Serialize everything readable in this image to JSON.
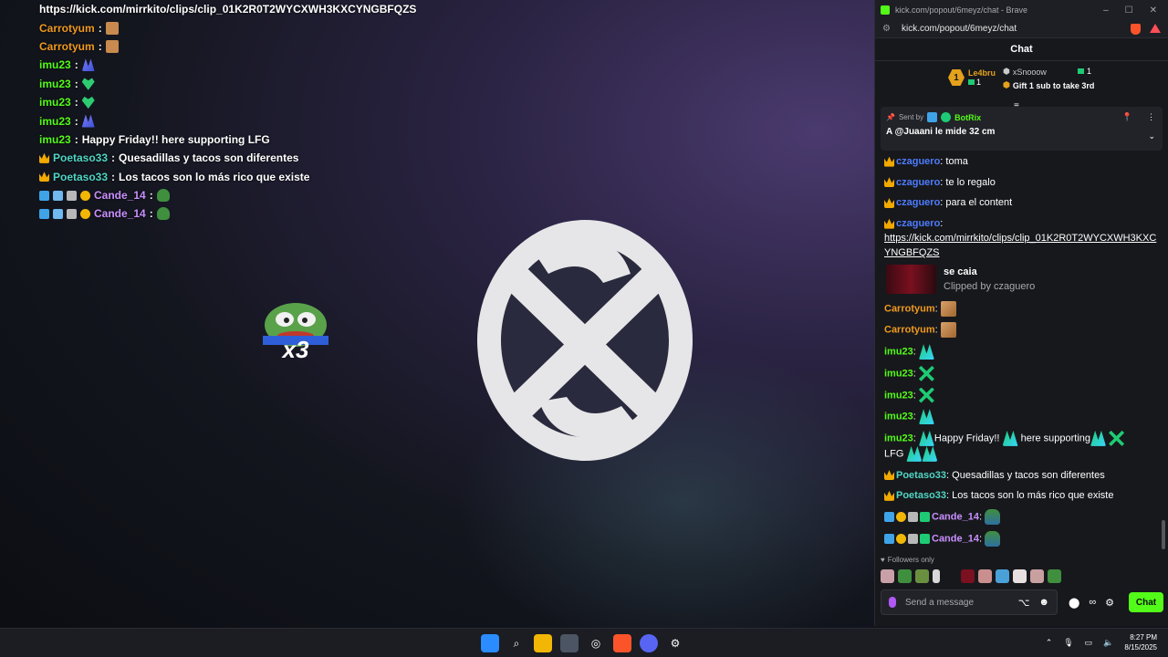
{
  "overlay_chat": [
    {
      "user": "https://kick.com/mirrkito/clips/clip_01K2R0T2WYCXWH3KXCYNGBFQZS",
      "color": "#ffffff",
      "badges": [],
      "emotes": [],
      "text": ""
    },
    {
      "user": "Carrotyum",
      "color": "#f09a1e",
      "badges": [],
      "emotes": [
        "box"
      ],
      "text": ""
    },
    {
      "user": "Carrotyum",
      "color": "#f09a1e",
      "badges": [],
      "emotes": [
        "box"
      ],
      "text": ""
    },
    {
      "user": "imu23",
      "color": "#53fc18",
      "badges": [],
      "emotes": [
        "wings"
      ],
      "text": ""
    },
    {
      "user": "imu23",
      "color": "#53fc18",
      "badges": [],
      "emotes": [
        "heart"
      ],
      "text": ""
    },
    {
      "user": "imu23",
      "color": "#53fc18",
      "badges": [],
      "emotes": [
        "heart"
      ],
      "text": ""
    },
    {
      "user": "imu23",
      "color": "#53fc18",
      "badges": [],
      "emotes": [
        "wings"
      ],
      "text": ""
    },
    {
      "user": "imu23",
      "color": "#53fc18",
      "badges": [],
      "emotes": [],
      "text": "Happy Friday!! here supporting LFG"
    },
    {
      "user": "Poetaso33",
      "color": "#4fd6c4",
      "badges": [
        "crown"
      ],
      "emotes": [],
      "text": "Quesadillas y tacos son diferentes"
    },
    {
      "user": "Poetaso33",
      "color": "#4fd6c4",
      "badges": [
        "crown"
      ],
      "emotes": [],
      "text": "Los tacos son lo más rico que existe"
    },
    {
      "user": "Cande_14",
      "color": "#c98fff",
      "badges": [
        "blue",
        "cube",
        "grey",
        "coin"
      ],
      "emotes": [
        "frog"
      ],
      "text": ""
    },
    {
      "user": "Cande_14",
      "color": "#c98fff",
      "badges": [
        "blue",
        "cube",
        "grey",
        "coin"
      ],
      "emotes": [
        "frog"
      ],
      "text": ""
    }
  ],
  "browser": {
    "title": "kick.com/popout/6meyz/chat - Brave",
    "url": "kick.com/popout/6meyz/chat",
    "controls": [
      "–",
      "☐",
      "✕"
    ]
  },
  "chat": {
    "header": "Chat",
    "leaderboard": {
      "first_rank": "1",
      "first_name": "Le4bru",
      "first_count": "1",
      "second_name": "xSnooow",
      "second_count": "1",
      "gift_text": "Gift 1 sub to take 3rd"
    },
    "pinned": {
      "sent_by": "Sent by",
      "bot": "BotRix",
      "message": "A @Juaani le mide 32 cm"
    },
    "messages": {
      "m1_user": "czaguero",
      "m1_text": "toma",
      "m2_user": "czaguero",
      "m2_text": "te lo regalo",
      "m3_user": "czaguero",
      "m3_text": "para el content",
      "m4_user": "czaguero",
      "m4_link": "https://kick.com/mirrkito/clips/clip_01K2R0T2WYCXWH3KXCYNGBFQZS",
      "clip_title": "se caia",
      "clip_by": "Clipped by czaguero",
      "m5_user": "Carrotyum",
      "m6_user": "Carrotyum",
      "m7_user": "imu23",
      "m8_user": "imu23",
      "m9_user": "imu23",
      "m10_user": "imu23",
      "m11_user": "imu23",
      "m11_t1": "Happy Friday!!",
      "m11_t2": "here supporting",
      "m11_t3": "LFG",
      "m12_user": "Poetaso33",
      "m12_text": "Quesadillas y tacos son diferentes",
      "m13_user": "Poetaso33",
      "m13_text": "Los tacos son lo más rico que existe",
      "m14_user": "Cande_14",
      "m15_user": "Cande_14"
    },
    "followers_only": "Followers only",
    "input_placeholder": "Send a message",
    "send_label": "Chat"
  },
  "taskbar": {
    "time": "8:27 PM",
    "date": "8/15/2025"
  },
  "colors": {
    "kick_green": "#53fc18",
    "czaguero": "#4d7cff",
    "carrotyum": "#f09a1e",
    "poetaso": "#4fd6c4",
    "cande": "#c98fff"
  }
}
